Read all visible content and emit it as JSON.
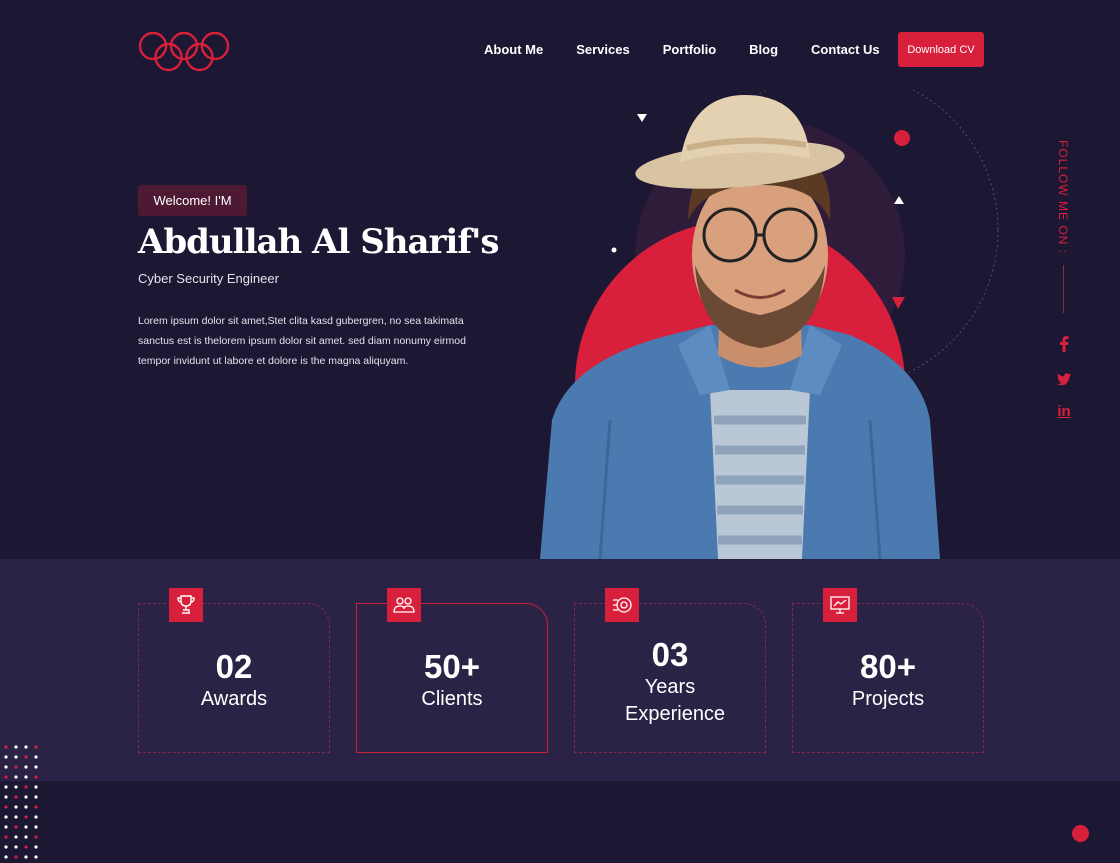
{
  "nav": {
    "links": [
      "About Me",
      "Services",
      "Portfolio",
      "Blog",
      "Contact Us"
    ],
    "cta": "Download CV"
  },
  "hero": {
    "welcome": "Welcome! I'M",
    "name": "Abdullah Al Sharif's",
    "role": "Cyber Security Engineer",
    "intro": "Lorem ipsum dolor sit amet,Stet clita kasd gubergren, no sea takimata sanctus est is thelorem ipsum dolor sit amet. sed diam nonumy eirmod tempor invidunt ut labore et dolore is the magna aliquyam."
  },
  "follow": {
    "label": "FOLLOW ME ON :",
    "socials": [
      "facebook-icon",
      "twitter-icon",
      "linkedin-icon"
    ],
    "twitter_glyph": "❦",
    "linkedin_glyph": "in"
  },
  "stats": [
    {
      "number": "02",
      "label": "Awards",
      "icon": "trophy-icon"
    },
    {
      "number": "50+",
      "label": "Clients",
      "icon": "clients-icon"
    },
    {
      "number": "03",
      "label": "Years Experience",
      "icon": "experience-icon"
    },
    {
      "number": "80+",
      "label": "Projects",
      "icon": "projects-icon"
    }
  ],
  "colors": {
    "background": "#1c1732",
    "stats_band": "#2b2346",
    "accent": "#d81f3b",
    "welcome_badge": "#4e1a33"
  }
}
